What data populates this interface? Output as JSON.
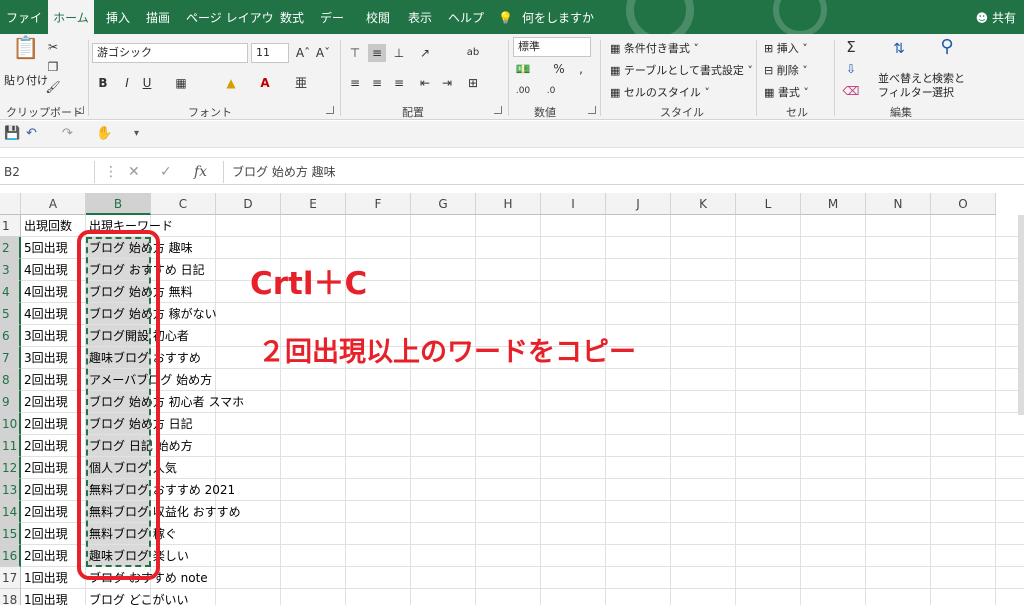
{
  "tabs": [
    "ファイル",
    "ホーム",
    "挿入",
    "描画",
    "ページ レイアウト",
    "数式",
    "データ",
    "校閲",
    "表示",
    "ヘルプ"
  ],
  "active_tab": "ホーム",
  "tell_me": "何をしますか",
  "share": "共有",
  "ribbon": {
    "clipboard": {
      "paste": "貼り付け",
      "label": "クリップボード"
    },
    "font": {
      "name": "游ゴシック",
      "size": "11",
      "label": "フォント",
      "bold": "B",
      "italic": "I",
      "underline": "U"
    },
    "alignment": {
      "label": "配置"
    },
    "number": {
      "format": "標準",
      "label": "数値"
    },
    "styles": {
      "conditional": "条件付き書式",
      "table": "テーブルとして書式設定",
      "cell": "セルのスタイル",
      "label": "スタイル"
    },
    "cells": {
      "insert": "挿入",
      "delete": "削除",
      "format": "書式",
      "label": "セル"
    },
    "editing": {
      "sort": "並べ替えと\nフィルター",
      "sort_line1": "並べ替えと",
      "sort_line2": "フィルター",
      "find_line1": "検索と",
      "find_line2": "選択",
      "label": "編集"
    }
  },
  "name_box": "B2",
  "formula": "ブログ 始め方 趣味",
  "columns": [
    "A",
    "B",
    "C",
    "D",
    "E",
    "F",
    "G",
    "H",
    "I",
    "J",
    "K",
    "L",
    "M",
    "N",
    "O"
  ],
  "rows": [
    {
      "n": "1",
      "a": "出現回数",
      "b": "出現キーワード"
    },
    {
      "n": "2",
      "a": "5回出現",
      "b": "ブログ 始め方 趣味"
    },
    {
      "n": "3",
      "a": "4回出現",
      "b": "ブログ おすすめ 日記"
    },
    {
      "n": "4",
      "a": "4回出現",
      "b": "ブログ 始め方 無料"
    },
    {
      "n": "5",
      "a": "4回出現",
      "b": "ブログ 始め方 稼がない"
    },
    {
      "n": "6",
      "a": "3回出現",
      "b": "ブログ開設 初心者"
    },
    {
      "n": "7",
      "a": "3回出現",
      "b": "趣味ブログ おすすめ"
    },
    {
      "n": "8",
      "a": "2回出現",
      "b": "アメーバブログ 始め方"
    },
    {
      "n": "9",
      "a": "2回出現",
      "b": "ブログ 始め方 初心者 スマホ"
    },
    {
      "n": "10",
      "a": "2回出現",
      "b": "ブログ 始め方 日記"
    },
    {
      "n": "11",
      "a": "2回出現",
      "b": "ブログ 日記 始め方"
    },
    {
      "n": "12",
      "a": "2回出現",
      "b": "個人ブログ 人気"
    },
    {
      "n": "13",
      "a": "2回出現",
      "b": "無料ブログ おすすめ 2021"
    },
    {
      "n": "14",
      "a": "2回出現",
      "b": "無料ブログ 収益化 おすすめ"
    },
    {
      "n": "15",
      "a": "2回出現",
      "b": "無料ブログ 稼ぐ"
    },
    {
      "n": "16",
      "a": "2回出現",
      "b": "趣味ブログ 楽しい"
    },
    {
      "n": "17",
      "a": "1回出現",
      "b": "ブログ おすすめ note"
    },
    {
      "n": "18",
      "a": "1回出現",
      "b": "ブログ どこがいい"
    }
  ],
  "annotation": {
    "shortcut": "Crtl＋C",
    "instruction": "２回出現以上のワードをコピー",
    "color": "#e6212a"
  },
  "colors": {
    "excel_green": "#217346",
    "selection_fill": "#d9d9d9"
  }
}
